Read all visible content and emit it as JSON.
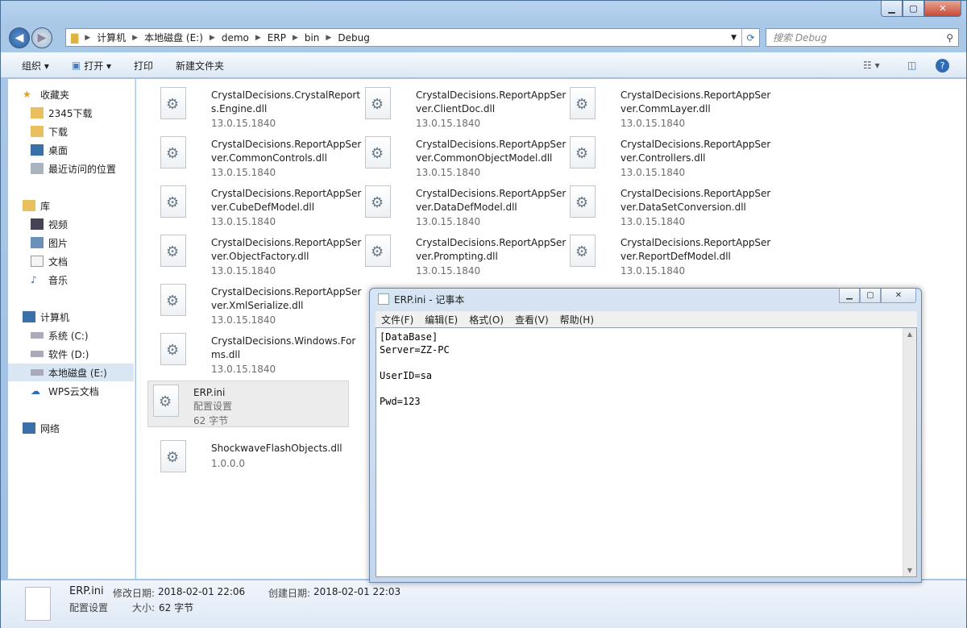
{
  "explorer": {
    "address": [
      "计算机",
      "本地磁盘 (E:)",
      "demo",
      "ERP",
      "bin",
      "Debug"
    ],
    "search_placeholder": "搜索 Debug",
    "toolbar": {
      "organize": "组织 ▾",
      "open": "打开 ▾",
      "print": "打印",
      "new_folder": "新建文件夹"
    },
    "sidebar": {
      "favorites": "收藏夹",
      "fav_items": [
        "2345下载",
        "下载",
        "桌面",
        "最近访问的位置"
      ],
      "libraries": "库",
      "lib_items": [
        "视频",
        "图片",
        "文档",
        "音乐"
      ],
      "computer": "计算机",
      "comp_items": [
        "系统 (C:)",
        "软件 (D:)",
        "本地磁盘 (E:)",
        "WPS云文档"
      ],
      "network": "网络"
    },
    "files": [
      {
        "name": "CrystalDecisions.CrystalReports.Engine.dll",
        "ver": "13.0.15.1840"
      },
      {
        "name": "CrystalDecisions.ReportAppServer.ClientDoc.dll",
        "ver": "13.0.15.1840"
      },
      {
        "name": "CrystalDecisions.ReportAppServer.CommLayer.dll",
        "ver": "13.0.15.1840"
      },
      {
        "name": "CrystalDecisions.ReportAppServer.CommonControls.dll",
        "ver": "13.0.15.1840"
      },
      {
        "name": "CrystalDecisions.ReportAppServer.CommonObjectModel.dll",
        "ver": "13.0.15.1840"
      },
      {
        "name": "CrystalDecisions.ReportAppServer.Controllers.dll",
        "ver": "13.0.15.1840"
      },
      {
        "name": "CrystalDecisions.ReportAppServer.CubeDefModel.dll",
        "ver": "13.0.15.1840"
      },
      {
        "name": "CrystalDecisions.ReportAppServer.DataDefModel.dll",
        "ver": "13.0.15.1840"
      },
      {
        "name": "CrystalDecisions.ReportAppServer.DataSetConversion.dll",
        "ver": "13.0.15.1840"
      },
      {
        "name": "CrystalDecisions.ReportAppServer.ObjectFactory.dll",
        "ver": "13.0.15.1840"
      },
      {
        "name": "CrystalDecisions.ReportAppServer.Prompting.dll",
        "ver": "13.0.15.1840"
      },
      {
        "name": "CrystalDecisions.ReportAppServer.ReportDefModel.dll",
        "ver": "13.0.15.1840"
      },
      {
        "name": "CrystalDecisions.ReportAppServer.XmlSerialize.dll",
        "ver": "13.0.15.1840"
      },
      {
        "name": "CrystalDecisions.Windows.Forms.dll",
        "ver": "13.0.15.1840"
      },
      {
        "name": "ERP.ini",
        "type": "配置设置",
        "ver": "62 字节"
      },
      {
        "name": "ShockwaveFlashObjects.dll",
        "ver": "1.0.0.0"
      }
    ],
    "status": {
      "name": "ERP.ini",
      "type": "配置设置",
      "modified_label": "修改日期:",
      "modified": "2018-02-01 22:06",
      "created_label": "创建日期:",
      "created": "2018-02-01 22:03",
      "size_label": "大小:",
      "size": "62 字节"
    }
  },
  "notepad": {
    "title": "ERP.ini - 记事本",
    "menu": [
      "文件(F)",
      "编辑(E)",
      "格式(O)",
      "查看(V)",
      "帮助(H)"
    ],
    "content": "[DataBase]\nServer=ZZ-PC\n\nUserID=sa\n\nPwd=123"
  }
}
